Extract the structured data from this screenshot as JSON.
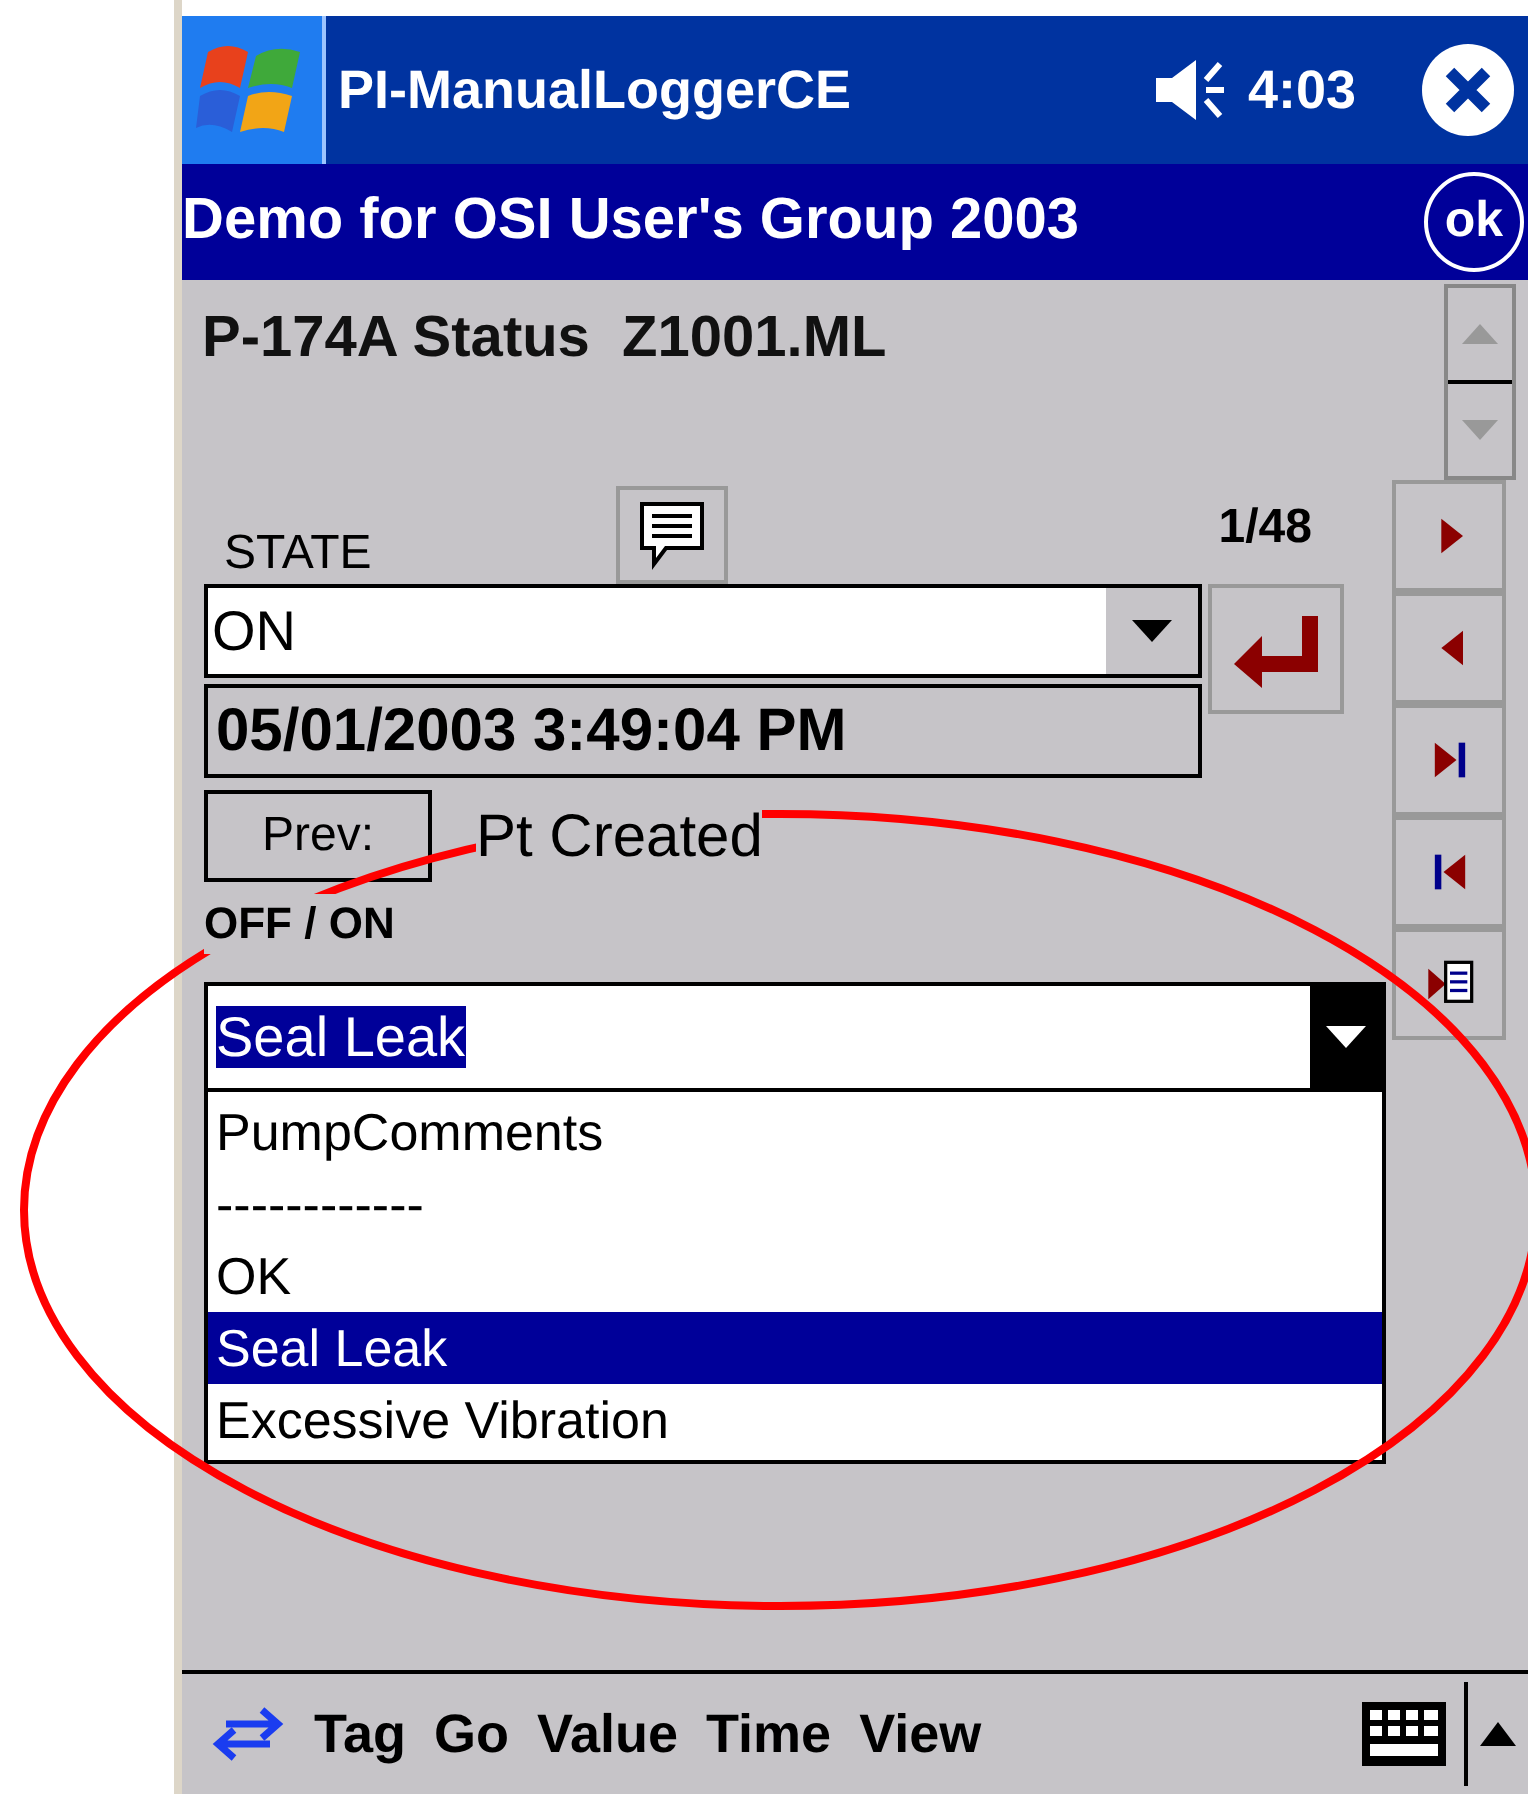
{
  "title_bar": {
    "title": "PI-ManualLoggerCE",
    "time": "4:03"
  },
  "header": {
    "title": "Demo for OSI User's Group 2003",
    "ok_button": "ok"
  },
  "tag_title": "P-174A Status  Z1001.ML",
  "state_label": "STATE",
  "counter": "1/48",
  "state_combo": {
    "value": "ON"
  },
  "timestamp": "05/01/2003 3:49:04 PM",
  "prev_button": "Prev:",
  "prev_value": "Pt Created",
  "digital_set": "OFF / ON",
  "comment_combo": {
    "value": "Seal Leak",
    "text_selected": true,
    "expanded": true
  },
  "options": [
    {
      "label": "PumpComments",
      "selected": false
    },
    {
      "label": "------------",
      "selected": false
    },
    {
      "label": "OK",
      "selected": false
    },
    {
      "label": "Seal Leak",
      "selected": true
    },
    {
      "label": "Excessive Vibration",
      "selected": false
    }
  ],
  "menu": [
    "Tag",
    "Go",
    "Value",
    "Time",
    "View"
  ]
}
